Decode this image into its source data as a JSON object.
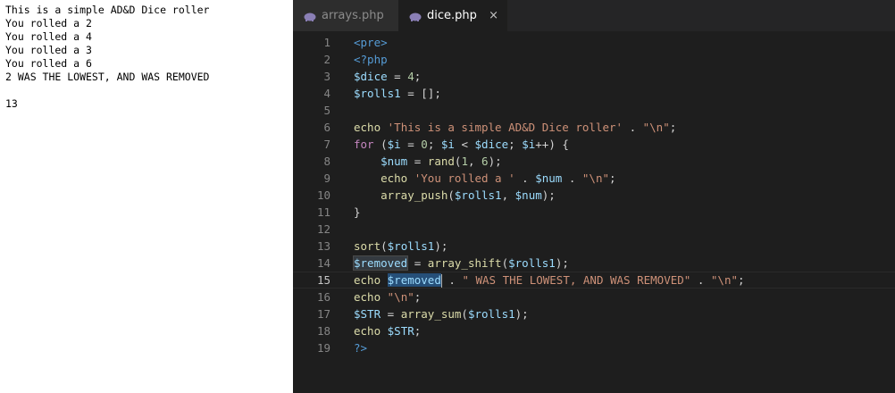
{
  "output": {
    "lines": [
      "This is a simple AD&D Dice roller",
      "You rolled a 2",
      "You rolled a 4",
      "You rolled a 3",
      "You rolled a 6",
      "2 WAS THE LOWEST, AND WAS REMOVED",
      "",
      "13"
    ]
  },
  "editor": {
    "tabs": [
      {
        "label": "arrays.php",
        "active": false
      },
      {
        "label": "dice.php",
        "active": true
      }
    ],
    "close_glyph": "×",
    "line_numbers": [
      "1",
      "2",
      "3",
      "4",
      "5",
      "6",
      "7",
      "8",
      "9",
      "10",
      "11",
      "12",
      "13",
      "14",
      "15",
      "16",
      "17",
      "18",
      "19"
    ],
    "current_line": 15,
    "code": [
      "<pre>",
      "<?php",
      "$dice = 4;",
      "$rolls1 = [];",
      "",
      "echo 'This is a simple AD&D Dice roller' . \"\\n\";",
      "for ($i = 0; $i < $dice; $i++) {",
      "    $num = rand(1, 6);",
      "    echo 'You rolled a ' . $num . \"\\n\";",
      "    array_push($rolls1, $num);",
      "}",
      "",
      "sort($rolls1);",
      "$removed = array_shift($rolls1);",
      "echo $removed . \" WAS THE LOWEST, AND WAS REMOVED\" . \"\\n\";",
      "echo \"\\n\";",
      "$STR = array_sum($rolls1);",
      "echo $STR;",
      "?>"
    ]
  },
  "colors": {
    "editor_bg": "#1e1e1e",
    "tabbar_bg": "#252526",
    "keyword": "#c586c0",
    "variable": "#9cdcfe",
    "string": "#ce9178",
    "number": "#b5cea8",
    "function": "#dcdcaa",
    "tag": "#569cd6"
  }
}
